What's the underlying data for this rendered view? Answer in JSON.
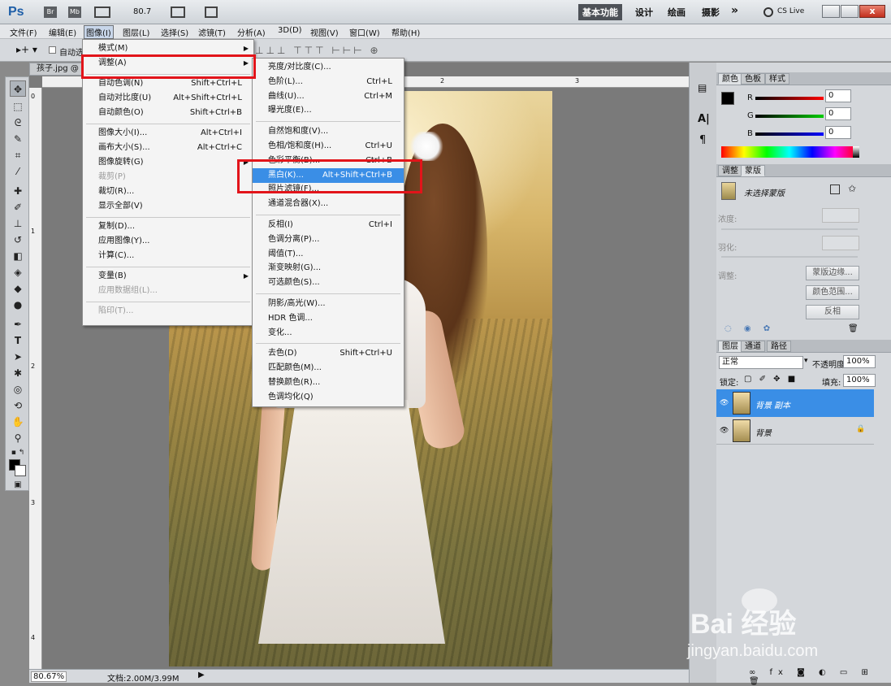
{
  "app": {
    "logo": "Ps",
    "bridge": "Br",
    "minibridge": "Mb",
    "zoom_combo": "80.7",
    "workspaces": [
      "基本功能",
      "设计",
      "绘画",
      "摄影"
    ],
    "more": "»",
    "cslive": "CS Live",
    "window_controls": [
      "minimize-icon",
      "restore-icon",
      "close-icon"
    ]
  },
  "menubar": [
    "文件(F)",
    "编辑(E)",
    "图像(I)",
    "图层(L)",
    "选择(S)",
    "滤镜(T)",
    "分析(A)",
    "3D(D)",
    "视图(V)",
    "窗口(W)",
    "帮助(H)"
  ],
  "options": {
    "auto_select": "自动选"
  },
  "document": {
    "tab": "孩子.jpg @",
    "ruler_top": [
      "0",
      "1",
      "2",
      "3"
    ],
    "ruler_left": [
      "0",
      "1",
      "2",
      "3",
      "4"
    ],
    "zoom": "80.67%",
    "doc_size": "文档:2.00M/3.99M"
  },
  "image_menu": {
    "items": [
      {
        "label": "模式(M)",
        "submenu": true
      },
      {
        "label": "调整(A)",
        "submenu": true,
        "highlighted": true
      },
      {
        "sep": true
      },
      {
        "label": "自动色调(N)",
        "shortcut": "Shift+Ctrl+L"
      },
      {
        "label": "自动对比度(U)",
        "shortcut": "Alt+Shift+Ctrl+L"
      },
      {
        "label": "自动颜色(O)",
        "shortcut": "Shift+Ctrl+B"
      },
      {
        "sep": true
      },
      {
        "label": "图像大小(I)...",
        "shortcut": "Alt+Ctrl+I"
      },
      {
        "label": "画布大小(S)...",
        "shortcut": "Alt+Ctrl+C"
      },
      {
        "label": "图像旋转(G)",
        "submenu": true
      },
      {
        "label": "裁剪(P)",
        "disabled": true
      },
      {
        "label": "裁切(R)..."
      },
      {
        "label": "显示全部(V)"
      },
      {
        "sep": true
      },
      {
        "label": "复制(D)..."
      },
      {
        "label": "应用图像(Y)..."
      },
      {
        "label": "计算(C)..."
      },
      {
        "sep": true
      },
      {
        "label": "变量(B)",
        "submenu": true
      },
      {
        "label": "应用数据组(L)...",
        "disabled": true
      },
      {
        "sep": true
      },
      {
        "label": "陷印(T)...",
        "disabled": true
      }
    ]
  },
  "adjust_menu": {
    "items": [
      {
        "label": "亮度/对比度(C)..."
      },
      {
        "label": "色阶(L)...",
        "shortcut": "Ctrl+L"
      },
      {
        "label": "曲线(U)...",
        "shortcut": "Ctrl+M"
      },
      {
        "label": "曝光度(E)..."
      },
      {
        "sep": true
      },
      {
        "label": "自然饱和度(V)..."
      },
      {
        "label": "色相/饱和度(H)...",
        "shortcut": "Ctrl+U"
      },
      {
        "label": "色彩平衡(B)...",
        "shortcut": "Ctrl+B"
      },
      {
        "label": "黑白(K)...",
        "shortcut": "Alt+Shift+Ctrl+B",
        "highlighted": true
      },
      {
        "label": "照片滤镜(F)..."
      },
      {
        "label": "通道混合器(X)..."
      },
      {
        "sep": true
      },
      {
        "label": "反相(I)",
        "shortcut": "Ctrl+I"
      },
      {
        "label": "色调分离(P)..."
      },
      {
        "label": "阈值(T)..."
      },
      {
        "label": "渐变映射(G)..."
      },
      {
        "label": "可选颜色(S)..."
      },
      {
        "sep": true
      },
      {
        "label": "阴影/高光(W)..."
      },
      {
        "label": "HDR 色调..."
      },
      {
        "label": "变化..."
      },
      {
        "sep": true
      },
      {
        "label": "去色(D)",
        "shortcut": "Shift+Ctrl+U"
      },
      {
        "label": "匹配颜色(M)..."
      },
      {
        "label": "替换颜色(R)..."
      },
      {
        "label": "色调均化(Q)"
      }
    ]
  },
  "color_panel": {
    "tabs": [
      "颜色",
      "色板",
      "样式"
    ],
    "channels": [
      {
        "label": "R",
        "value": "0",
        "color": "#d42020"
      },
      {
        "label": "G",
        "value": "0",
        "color": "#1ea81e"
      },
      {
        "label": "B",
        "value": "0",
        "color": "#2030d0"
      }
    ]
  },
  "masks_panel": {
    "tabs": [
      "调整",
      "蒙版"
    ],
    "title": "未选择蒙版",
    "density_label": "浓度:",
    "feather_label": "羽化:",
    "adjust_label": "调整:",
    "buttons": [
      "蒙版边缘...",
      "颜色范围...",
      "反相"
    ]
  },
  "layers_panel": {
    "tabs": [
      "图层",
      "通道",
      "路径"
    ],
    "blend_mode": "正常",
    "opacity_label": "不透明度:",
    "opacity": "100%",
    "lock_label": "锁定:",
    "fill_label": "填充:",
    "fill": "100%",
    "layers": [
      {
        "name": "背景 副本",
        "selected": true
      },
      {
        "name": "背景",
        "locked": true
      }
    ]
  },
  "watermark": {
    "logo": "Bai 经验",
    "url": "jingyan.baidu.com"
  },
  "colors": {
    "accent": "#3a8ee6",
    "callout": "#e2141a"
  }
}
